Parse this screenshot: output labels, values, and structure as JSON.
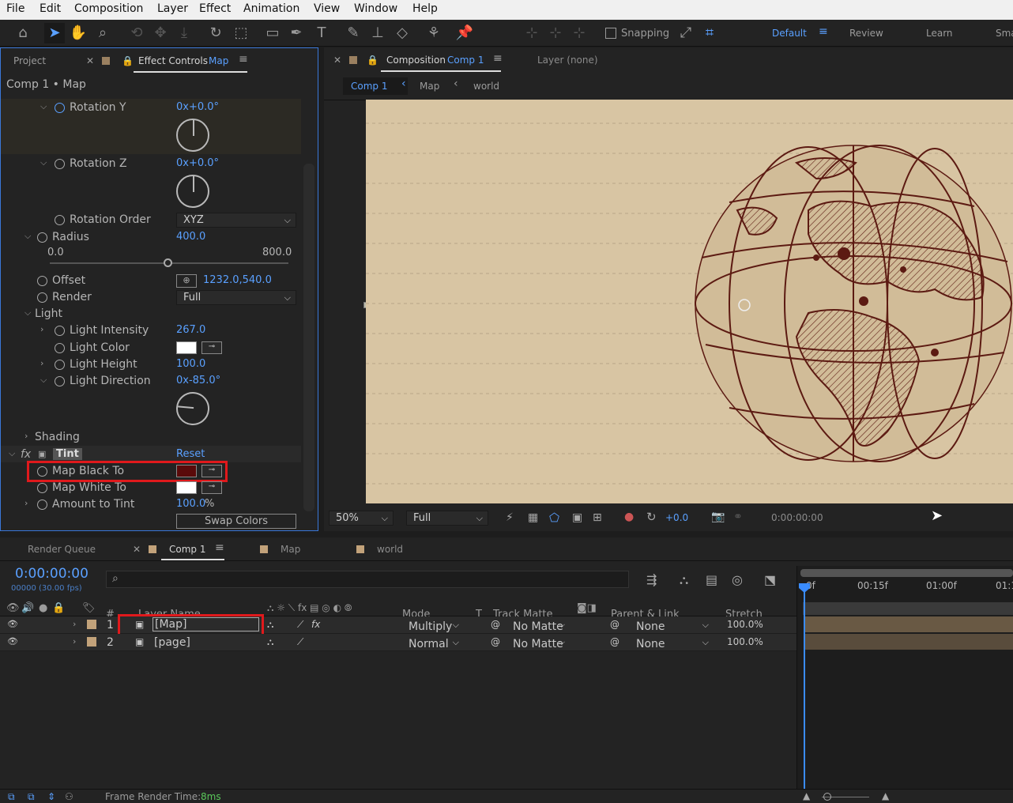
{
  "menu": [
    "File",
    "Edit",
    "Composition",
    "Layer",
    "Effect",
    "Animation",
    "View",
    "Window",
    "Help"
  ],
  "toolbar": {
    "snapping": "Snapping"
  },
  "workspaces": {
    "default": "Default",
    "review": "Review",
    "learn": "Learn",
    "more": "Sma"
  },
  "left_panel": {
    "tab_project": "Project",
    "tab_effect_controls": "Effect Controls",
    "tab_effect_layer": "Map",
    "breadcrumb": "Comp 1 • Map",
    "rotation_y": {
      "label": "Rotation Y",
      "value": "0x+0.0°"
    },
    "rotation_z": {
      "label": "Rotation Z",
      "value": "0x+0.0°"
    },
    "rotation_order": {
      "label": "Rotation Order",
      "value": "XYZ"
    },
    "radius": {
      "label": "Radius",
      "value": "400.0",
      "min": "0.0",
      "max": "800.0",
      "fraction": 0.5
    },
    "offset": {
      "label": "Offset",
      "value": "1232.0,540.0"
    },
    "render": {
      "label": "Render",
      "value": "Full"
    },
    "light": {
      "label": "Light"
    },
    "light_intensity": {
      "label": "Light Intensity",
      "value": "267.0"
    },
    "light_color": {
      "label": "Light Color",
      "color": "#ffffff"
    },
    "light_height": {
      "label": "Light Height",
      "value": "100.0"
    },
    "light_direction": {
      "label": "Light Direction",
      "value": "0x-85.0°"
    },
    "shading": {
      "label": "Shading"
    },
    "tint": {
      "fx": "fx",
      "label": "Tint",
      "reset": "Reset"
    },
    "map_black_to": {
      "label": "Map Black To",
      "color": "#5a0a0a"
    },
    "map_white_to": {
      "label": "Map White To",
      "color": "#ffffff"
    },
    "amount_to_tint": {
      "label": "Amount to Tint",
      "value": "100.0",
      "unit": "%"
    },
    "swap_colors": "Swap Colors"
  },
  "comp_panel": {
    "tab_composition": "Composition",
    "tab_comp_name": "Comp 1",
    "tab_layer": "Layer (none)",
    "crumbs": [
      "Comp 1",
      "Map",
      "world"
    ],
    "zoom": "50%",
    "resolution": "Full",
    "exposure": "+0.0",
    "timecode": "0:00:00:00"
  },
  "timeline": {
    "tabs": [
      "Render Queue",
      "Comp 1",
      "Map",
      "world"
    ],
    "timecode": "0:00:00:00",
    "frames": "00000 (30.00 fps)",
    "headers": {
      "num": "#",
      "layer_name": "Layer Name",
      "mode": "Mode",
      "t": "T",
      "track_matte": "Track Matte",
      "parent": "Parent & Link",
      "stretch": "Stretch"
    },
    "ruler": [
      "0f",
      "00:15f",
      "01:00f",
      "01:1"
    ],
    "layers": [
      {
        "num": "1",
        "name": "[Map]",
        "mode": "Multiply",
        "matte": "No Matte",
        "parent": "None",
        "stretch": "100.0%"
      },
      {
        "num": "2",
        "name": "[page]",
        "mode": "Normal",
        "matte": "No Matte",
        "parent": "None",
        "stretch": "100.0%"
      }
    ]
  },
  "status": {
    "label": "Frame Render Time:",
    "value": "8ms"
  },
  "colors": {
    "accent": "#5aa0ff",
    "highlight": "#e0191c",
    "paper": "#d8c5a3",
    "ink": "#5c1a12"
  }
}
